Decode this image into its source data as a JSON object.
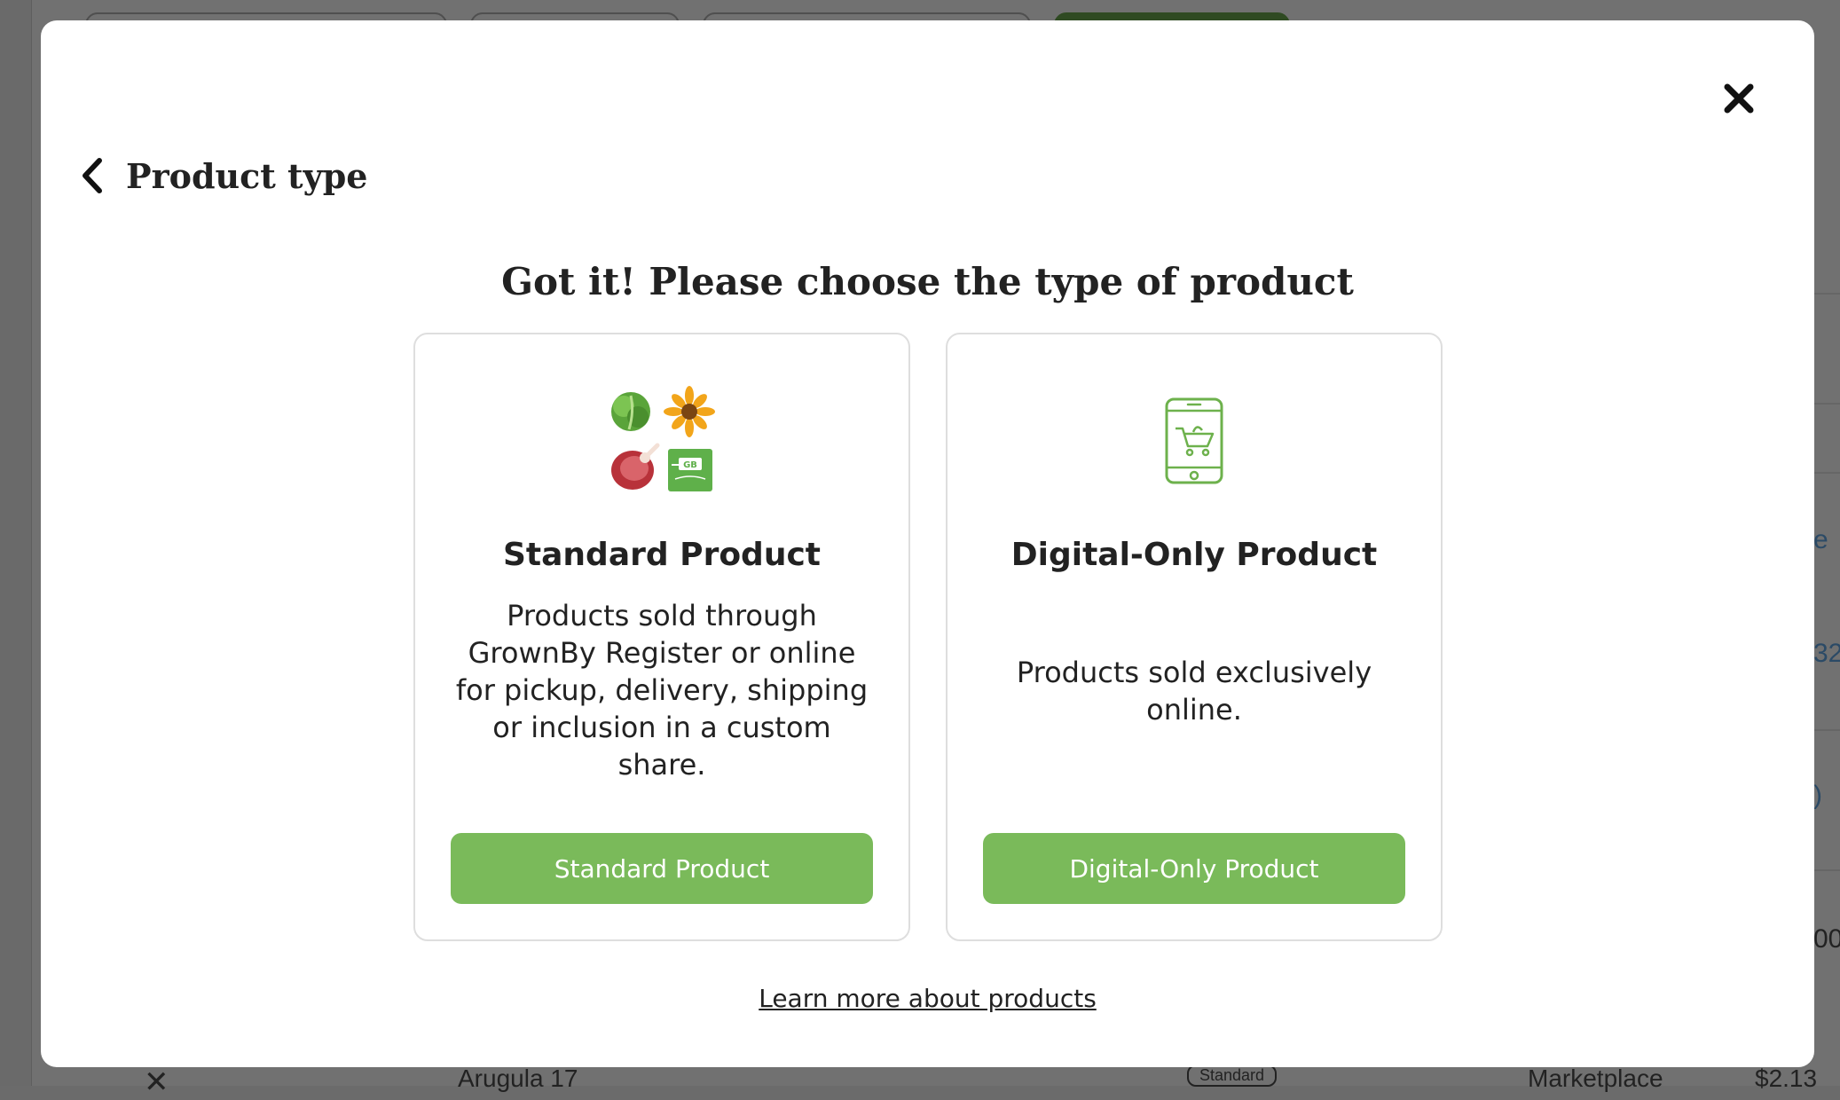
{
  "background": {
    "row_item_name": "Arugula 17",
    "row_badge": "Standard",
    "row_channel": "Marketplace",
    "row_price": "$2.13",
    "right_fragments": [
      "e",
      "32",
      ")",
      "00"
    ]
  },
  "modal": {
    "header_title": "Product type",
    "prompt": "Got it! Please choose the type of product",
    "cards": {
      "standard": {
        "title": "Standard Product",
        "description": "Products sold through GrownBy Register or online for pickup, delivery, shipping or inclusion in a custom share.",
        "button_label": "Standard Product",
        "icon": "produce-collage-icon",
        "badge_text": "GB"
      },
      "digital": {
        "title": "Digital-Only Product",
        "description": "Products sold exclusively online.",
        "button_label": "Digital-Only Product",
        "icon": "phone-cart-icon"
      }
    },
    "learn_more_label": "Learn more about products"
  },
  "colors": {
    "accent_green": "#7aba5a",
    "icon_green": "#6db14c",
    "text_dark": "#222222"
  }
}
